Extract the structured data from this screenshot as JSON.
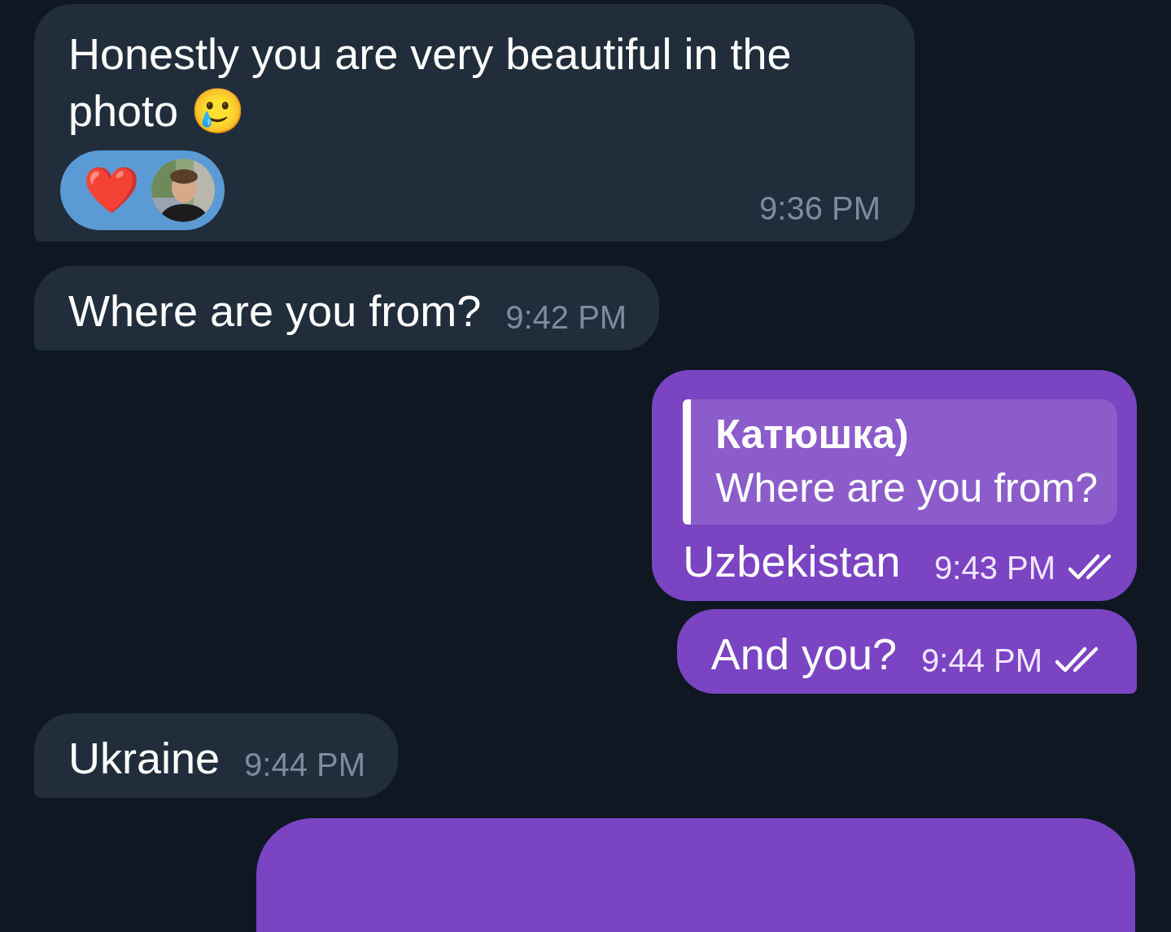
{
  "messages": [
    {
      "kind": "text",
      "outgoing": false,
      "text": "Honestly you are very beautiful in the photo 🥲",
      "time": "9:36 PM",
      "reaction": {
        "emoji": "❤️"
      }
    },
    {
      "kind": "text",
      "outgoing": false,
      "text": "Where are you from?",
      "time": "9:42 PM"
    },
    {
      "kind": "text",
      "outgoing": true,
      "reply": {
        "author": "Катюшка)",
        "text": "Where are you from?"
      },
      "text": "Uzbekistan",
      "time": "9:43 PM",
      "read": true
    },
    {
      "kind": "text",
      "outgoing": true,
      "text": "And you?",
      "time": "9:44 PM",
      "read": true
    },
    {
      "kind": "text",
      "outgoing": false,
      "text": "Ukraine",
      "time": "9:44 PM"
    },
    {
      "kind": "partial",
      "outgoing": true
    }
  ]
}
